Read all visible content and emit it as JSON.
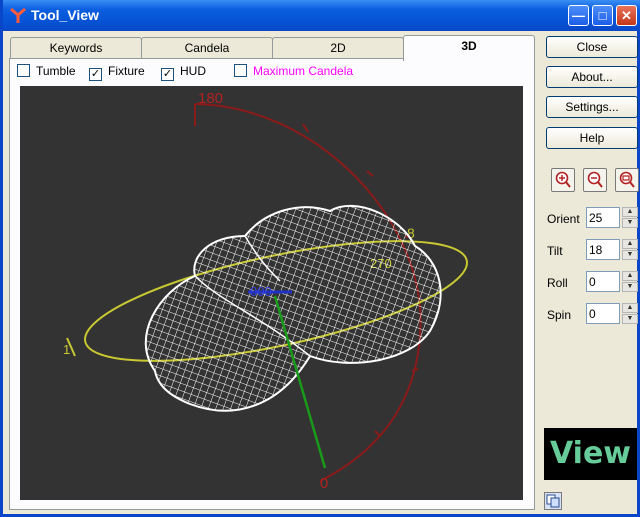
{
  "window": {
    "title": "Tool_View"
  },
  "tabs": [
    {
      "label": "Keywords",
      "active": false
    },
    {
      "label": "Candela",
      "active": false
    },
    {
      "label": "2D",
      "active": false
    },
    {
      "label": "3D",
      "active": true
    }
  ],
  "options": [
    {
      "label": "Tumble",
      "checked": false,
      "color": "#000000"
    },
    {
      "label": "Fixture",
      "checked": true,
      "color": "#000000"
    },
    {
      "label": "HUD",
      "checked": true,
      "color": "#000000"
    },
    {
      "label": "Maximum Candela",
      "checked": false,
      "color": "#ff00ff"
    }
  ],
  "viewport_labels": {
    "red_top": "180",
    "red_bottom": "0",
    "yellow_mark": "270",
    "yellow_left": "1",
    "red_side": "8",
    "center": "000"
  },
  "side_buttons": [
    "Close",
    "About...",
    "Settings...",
    "Help"
  ],
  "zoom_icons": [
    "zoom-in-icon",
    "zoom-out-icon",
    "zoom-fit-icon"
  ],
  "controls": [
    {
      "label": "Orient",
      "value": "25"
    },
    {
      "label": "Tilt",
      "value": "18"
    },
    {
      "label": "Roll",
      "value": "0"
    },
    {
      "label": "Spin",
      "value": "0"
    }
  ],
  "brand": "View",
  "colors": {
    "title_bar": "#0a47c8",
    "viewport_bg": "#333333",
    "red_axis": "#8b1a1a",
    "yellow_ring": "#c8c832",
    "green_axis": "#1a9a1a",
    "brand_text": "#66cc99"
  }
}
